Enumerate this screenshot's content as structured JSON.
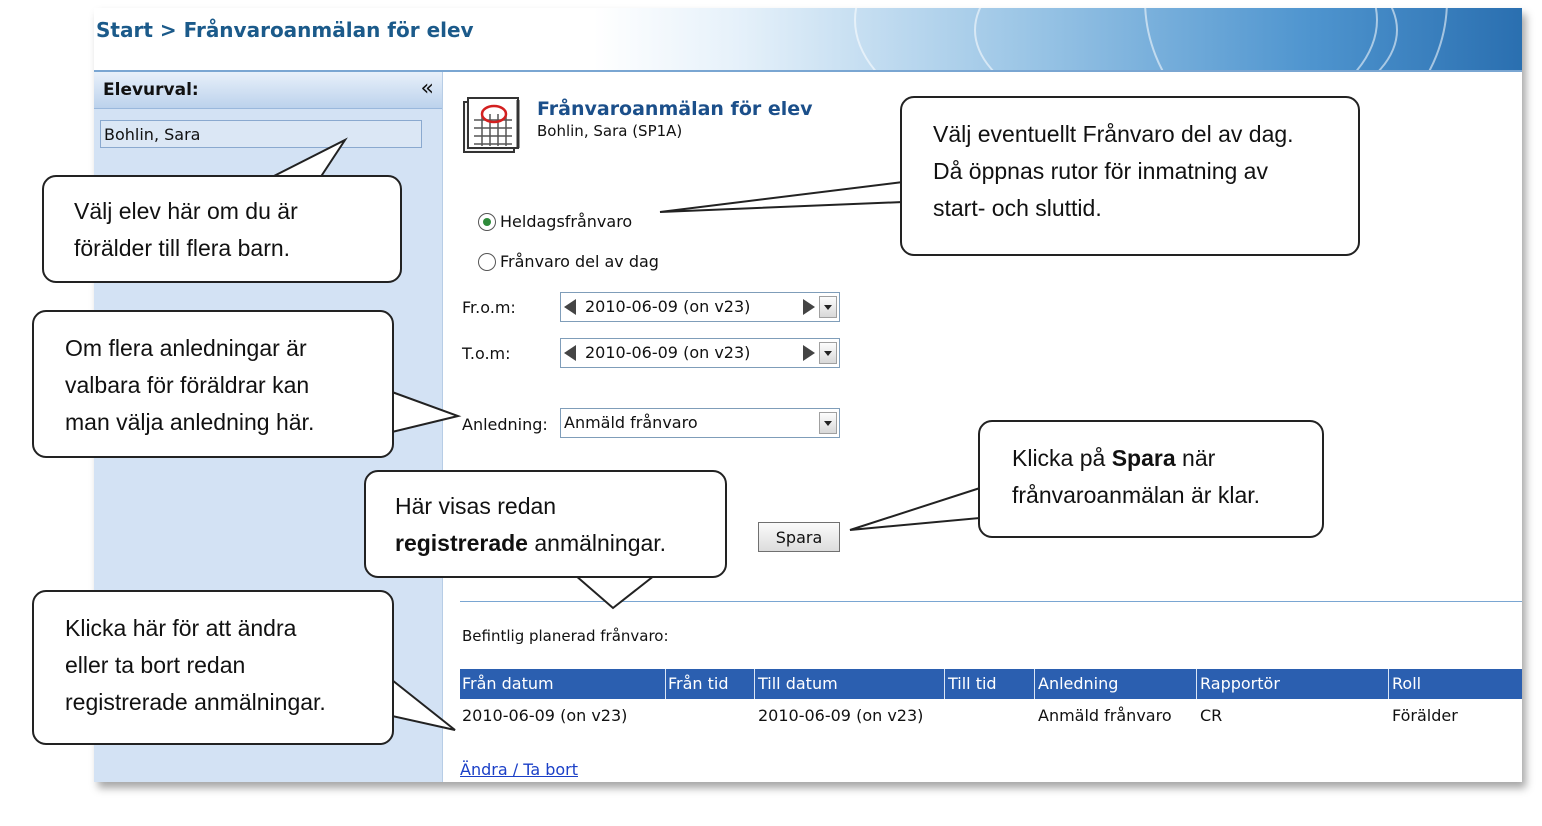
{
  "breadcrumb": "Start > Frånvaroanmälan för elev",
  "sidebar": {
    "title": "Elevurval:",
    "collapse_glyph": "«",
    "selected_student": "Bohlin, Sara"
  },
  "form": {
    "title": "Frånvaroanmälan för elev",
    "subtitle": "Bohlin, Sara  (SP1A)",
    "radio_full_day": "Heldagsfrånvaro",
    "radio_part_day": "Frånvaro del av dag",
    "selected_radio": "full_day",
    "from_label": "Fr.o.m:",
    "from_value": "2010-06-09 (on v23)",
    "to_label": "T.o.m:",
    "to_value": "2010-06-09 (on v23)",
    "reason_label": "Anledning:",
    "reason_value": "Anmäld frånvaro",
    "save_label": "Spara"
  },
  "existing": {
    "label": "Befintlig planerad frånvaro:",
    "columns": [
      "Från datum",
      "Från tid",
      "Till datum",
      "Till tid",
      "Anledning",
      "Rapportör",
      "Roll"
    ],
    "rows": [
      [
        "2010-06-09 (on v23)",
        "",
        "2010-06-09 (on v23)",
        "",
        "Anmäld frånvaro",
        "CR",
        "Förälder"
      ]
    ],
    "edit_link": "Ändra / Ta bort"
  },
  "callouts": {
    "student": [
      "Välj elev här om du är",
      "förälder till flera barn."
    ],
    "part_day": [
      "Välj eventuellt Frånvaro del av dag.",
      "Då öppnas rutor för inmatning av",
      "start- och sluttid."
    ],
    "reason": [
      "Om flera anledningar är",
      "valbara för föräldrar kan",
      "man välja anledning här."
    ],
    "save_pre": "Klicka på ",
    "save_bold": "Spara",
    "save_post": " när",
    "save_line2": "frånvaroanmälan är klar.",
    "registered_line1": "Här visas redan",
    "registered_bold": "registrerade",
    "registered_post": " anmälningar.",
    "edit": [
      "Klicka här för att ändra",
      "eller ta bort redan",
      "registrerade anmälningar."
    ]
  },
  "colors": {
    "table_header": "#2b5fb0",
    "sidebar_bg": "#d3e2f4",
    "title_blue": "#1b4f8a",
    "link_blue": "#1a3fc7"
  }
}
